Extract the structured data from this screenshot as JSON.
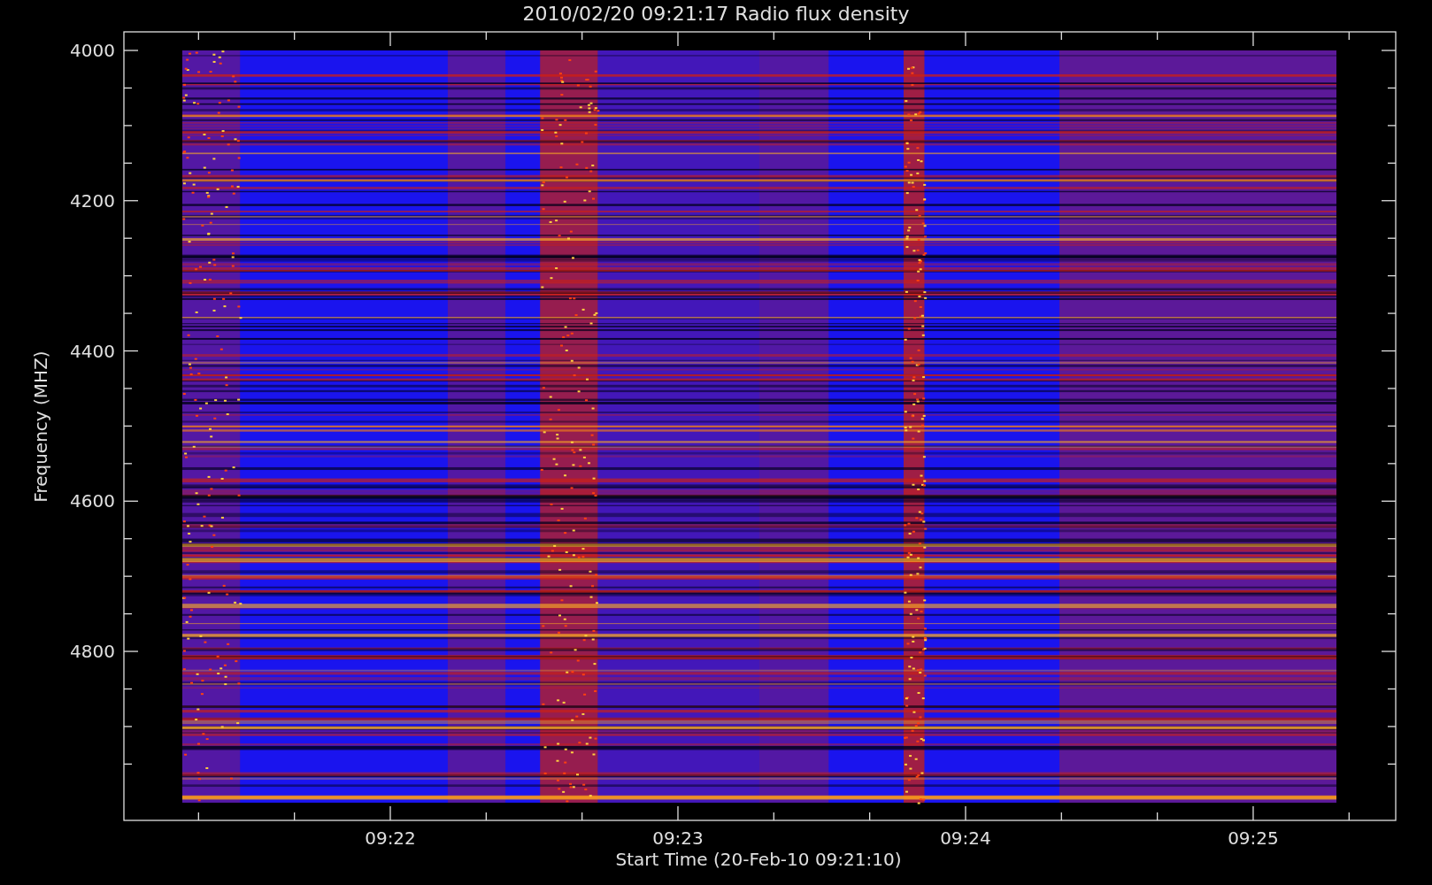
{
  "title": "2010/02/20 09:21:17 Radio flux density",
  "y_axis": {
    "label": "Frequency (MHZ)",
    "ticks": [
      "4000",
      "4200",
      "4400",
      "4600",
      "4800"
    ]
  },
  "x_axis": {
    "label": "Start Time (20-Feb-10 09:21:10)",
    "ticks": [
      "09:22",
      "09:23",
      "09:24",
      "09:25"
    ]
  }
}
